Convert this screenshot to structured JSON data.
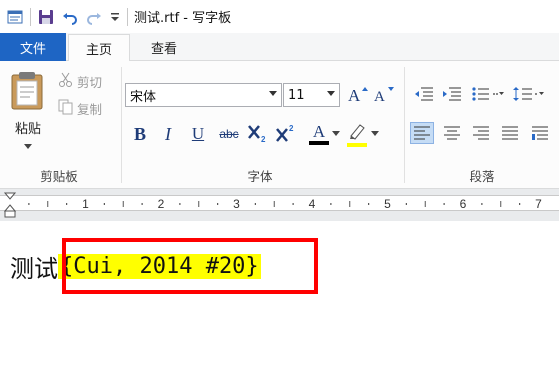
{
  "window": {
    "title": "测试.rtf - 写字板"
  },
  "tabs": {
    "file": "文件",
    "home": "主页",
    "view": "查看"
  },
  "clipboard": {
    "paste": "粘贴",
    "cut": "剪切",
    "copy": "复制",
    "group_label": "剪贴板"
  },
  "font": {
    "family": "宋体",
    "size": "11",
    "group_label": "字体",
    "bold": "B",
    "italic": "I",
    "underline": "U",
    "strike": "abc",
    "color_letter": "A"
  },
  "paragraph": {
    "group_label": "段落"
  },
  "ruler": {
    "numbers": [
      "1",
      "2",
      "3",
      "4",
      "5",
      "6",
      "7"
    ]
  },
  "document": {
    "plain_text": "测试",
    "highlighted_text": "{Cui, 2014 #20}"
  },
  "colors": {
    "file_tab": "#1e65c4",
    "highlight": "#ffff00",
    "annotation_box": "#ff0000",
    "font_color_bar": "#000000",
    "highlight_bar": "#ffff00"
  }
}
